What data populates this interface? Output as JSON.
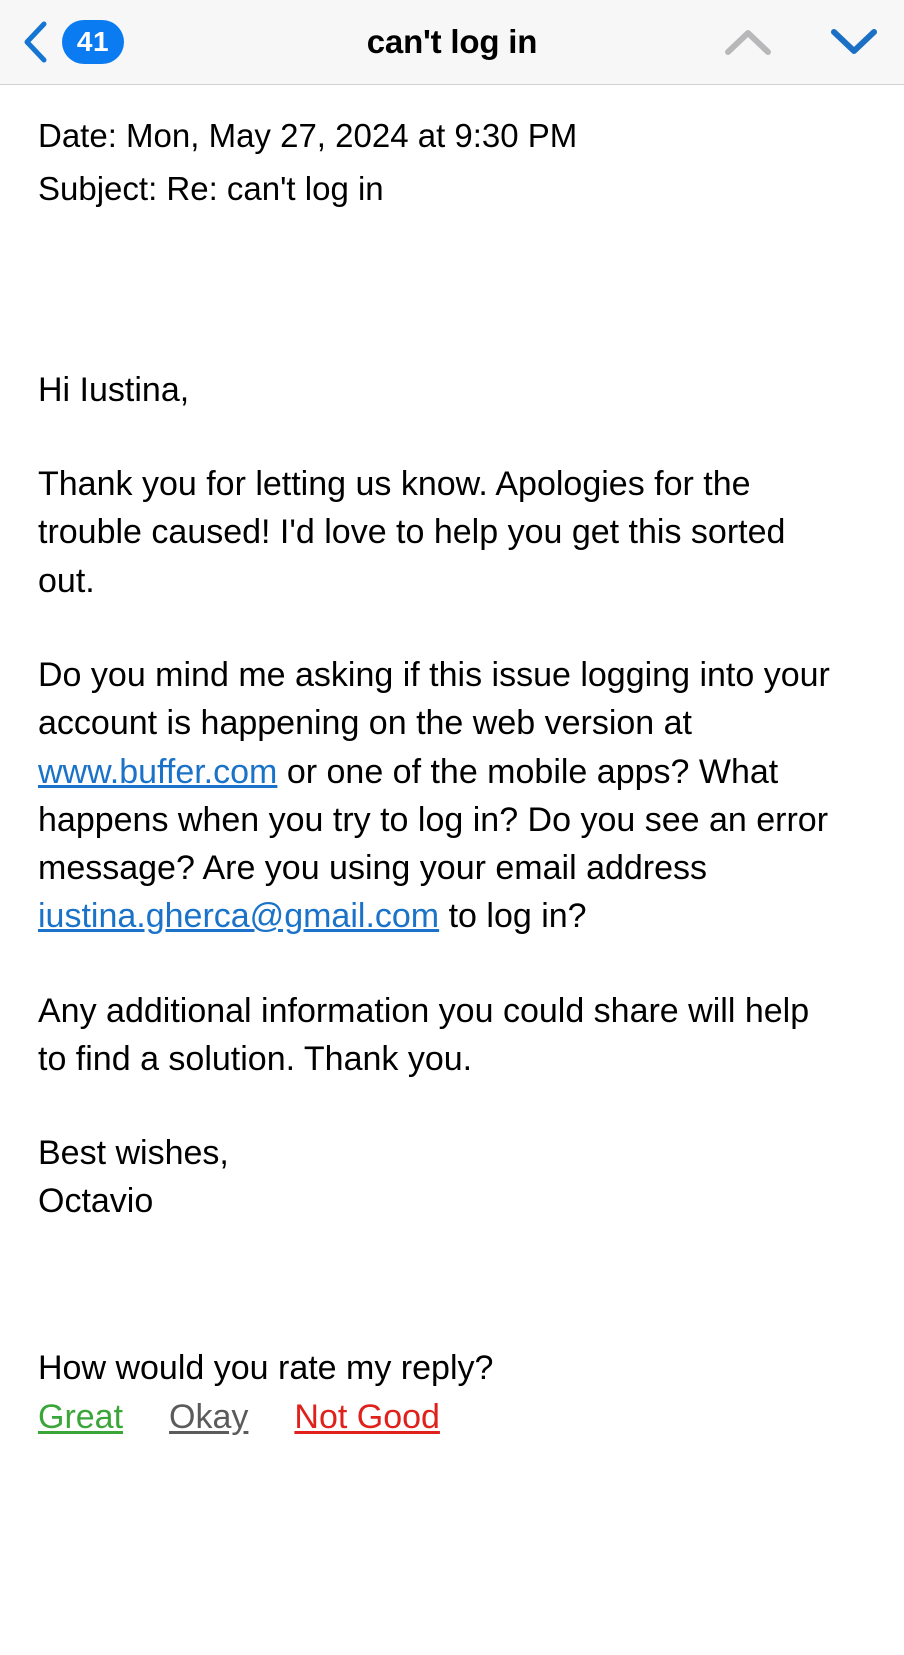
{
  "navbar": {
    "back_icon": "chevron-left-icon",
    "unread_count": "41",
    "title": "can't log in",
    "prev_icon": "chevron-up-icon",
    "next_icon": "chevron-down-icon",
    "prev_enabled_color": "#b8b8ba",
    "next_enabled_color": "#1b6fc4",
    "badge_color": "#0b7bf1",
    "background": "#f7f7f7"
  },
  "message": {
    "date_label": "Date:",
    "date_value": "Mon, May 27, 2024 at 9:30 PM",
    "date_line": "Date: Mon, May 27, 2024 at 9:30 PM",
    "subject_label": "Subject:",
    "subject_value": "Re: can't log in",
    "subject_line": "Subject: Re: can't log in",
    "greeting": "Hi Iustina,",
    "paragraph_1": "Thank you for letting us know. Apologies for the trouble caused! I'd love to help you get this sorted out.",
    "paragraph_2": {
      "part_1": "Do you mind me asking if this issue logging into your account is happening on the web version at ",
      "link_url_text": "www.buffer.com",
      "part_2": " or one of the mobile apps? What happens when you try to log in? Do you see an error message? Are you using your email address ",
      "link_email_text": "iustina.gherca@gmail.com",
      "part_3": " to log in?"
    },
    "paragraph_3": "Any additional information you could share will help to find a solution. Thank you.",
    "signoff": "Best wishes,",
    "sender_name": "Octavio",
    "link_color": "#1a73c8"
  },
  "rating": {
    "question": "How would you rate my reply?",
    "options": [
      {
        "label": "Great",
        "color": "#3aa63a"
      },
      {
        "label": "Okay",
        "color": "#5b5b5b"
      },
      {
        "label": "Not Good",
        "color": "#e0201b"
      }
    ]
  }
}
